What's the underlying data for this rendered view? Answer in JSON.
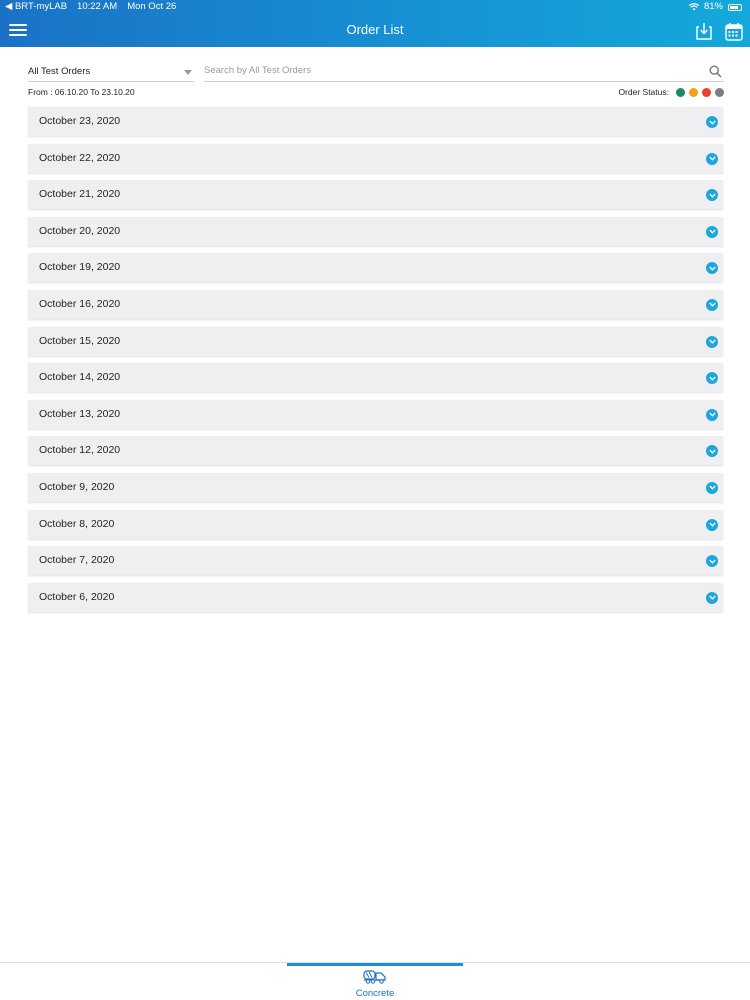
{
  "status_bar": {
    "back_app": "BRT-myLAB",
    "time": "10:22 AM",
    "date": "Mon Oct 26",
    "battery": "81%"
  },
  "header": {
    "title": "Order List",
    "colors": {
      "gradient_start": "#1a72c6",
      "gradient_end": "#13a9dc"
    }
  },
  "filter": {
    "selected": "All Test Orders",
    "search_placeholder": "Search by All Test Orders",
    "search_value": ""
  },
  "date_range": "From : 06.10.20 To 23.10.20",
  "order_status": {
    "label": "Order Status:",
    "colors": [
      "#1a8a6a",
      "#f0a21c",
      "#e5412b",
      "#7d7d7d"
    ]
  },
  "orders": [
    {
      "date": "October 23, 2020"
    },
    {
      "date": "October 22, 2020"
    },
    {
      "date": "October 21, 2020"
    },
    {
      "date": "October 20, 2020"
    },
    {
      "date": "October 19, 2020"
    },
    {
      "date": "October 16, 2020"
    },
    {
      "date": "October 15, 2020"
    },
    {
      "date": "October 14, 2020"
    },
    {
      "date": "October 13, 2020"
    },
    {
      "date": "October 12, 2020"
    },
    {
      "date": "October 9, 2020"
    },
    {
      "date": "October 8, 2020"
    },
    {
      "date": "October 7, 2020"
    },
    {
      "date": "October 6, 2020"
    }
  ],
  "tabs": [
    {
      "label": "Concrete",
      "icon": "concrete-truck-icon",
      "active": true
    }
  ],
  "accent_color": "#1ea7dd"
}
